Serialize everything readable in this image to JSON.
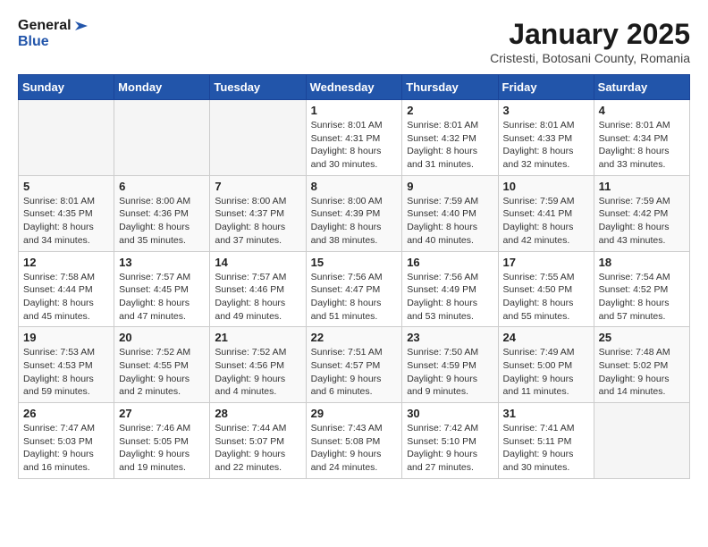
{
  "header": {
    "logo_general": "General",
    "logo_blue": "Blue",
    "month_title": "January 2025",
    "subtitle": "Cristesti, Botosani County, Romania"
  },
  "weekdays": [
    "Sunday",
    "Monday",
    "Tuesday",
    "Wednesday",
    "Thursday",
    "Friday",
    "Saturday"
  ],
  "weeks": [
    [
      {
        "day": "",
        "sunrise": "",
        "sunset": "",
        "daylight": ""
      },
      {
        "day": "",
        "sunrise": "",
        "sunset": "",
        "daylight": ""
      },
      {
        "day": "",
        "sunrise": "",
        "sunset": "",
        "daylight": ""
      },
      {
        "day": "1",
        "sunrise": "Sunrise: 8:01 AM",
        "sunset": "Sunset: 4:31 PM",
        "daylight": "Daylight: 8 hours and 30 minutes."
      },
      {
        "day": "2",
        "sunrise": "Sunrise: 8:01 AM",
        "sunset": "Sunset: 4:32 PM",
        "daylight": "Daylight: 8 hours and 31 minutes."
      },
      {
        "day": "3",
        "sunrise": "Sunrise: 8:01 AM",
        "sunset": "Sunset: 4:33 PM",
        "daylight": "Daylight: 8 hours and 32 minutes."
      },
      {
        "day": "4",
        "sunrise": "Sunrise: 8:01 AM",
        "sunset": "Sunset: 4:34 PM",
        "daylight": "Daylight: 8 hours and 33 minutes."
      }
    ],
    [
      {
        "day": "5",
        "sunrise": "Sunrise: 8:01 AM",
        "sunset": "Sunset: 4:35 PM",
        "daylight": "Daylight: 8 hours and 34 minutes."
      },
      {
        "day": "6",
        "sunrise": "Sunrise: 8:00 AM",
        "sunset": "Sunset: 4:36 PM",
        "daylight": "Daylight: 8 hours and 35 minutes."
      },
      {
        "day": "7",
        "sunrise": "Sunrise: 8:00 AM",
        "sunset": "Sunset: 4:37 PM",
        "daylight": "Daylight: 8 hours and 37 minutes."
      },
      {
        "day": "8",
        "sunrise": "Sunrise: 8:00 AM",
        "sunset": "Sunset: 4:39 PM",
        "daylight": "Daylight: 8 hours and 38 minutes."
      },
      {
        "day": "9",
        "sunrise": "Sunrise: 7:59 AM",
        "sunset": "Sunset: 4:40 PM",
        "daylight": "Daylight: 8 hours and 40 minutes."
      },
      {
        "day": "10",
        "sunrise": "Sunrise: 7:59 AM",
        "sunset": "Sunset: 4:41 PM",
        "daylight": "Daylight: 8 hours and 42 minutes."
      },
      {
        "day": "11",
        "sunrise": "Sunrise: 7:59 AM",
        "sunset": "Sunset: 4:42 PM",
        "daylight": "Daylight: 8 hours and 43 minutes."
      }
    ],
    [
      {
        "day": "12",
        "sunrise": "Sunrise: 7:58 AM",
        "sunset": "Sunset: 4:44 PM",
        "daylight": "Daylight: 8 hours and 45 minutes."
      },
      {
        "day": "13",
        "sunrise": "Sunrise: 7:57 AM",
        "sunset": "Sunset: 4:45 PM",
        "daylight": "Daylight: 8 hours and 47 minutes."
      },
      {
        "day": "14",
        "sunrise": "Sunrise: 7:57 AM",
        "sunset": "Sunset: 4:46 PM",
        "daylight": "Daylight: 8 hours and 49 minutes."
      },
      {
        "day": "15",
        "sunrise": "Sunrise: 7:56 AM",
        "sunset": "Sunset: 4:47 PM",
        "daylight": "Daylight: 8 hours and 51 minutes."
      },
      {
        "day": "16",
        "sunrise": "Sunrise: 7:56 AM",
        "sunset": "Sunset: 4:49 PM",
        "daylight": "Daylight: 8 hours and 53 minutes."
      },
      {
        "day": "17",
        "sunrise": "Sunrise: 7:55 AM",
        "sunset": "Sunset: 4:50 PM",
        "daylight": "Daylight: 8 hours and 55 minutes."
      },
      {
        "day": "18",
        "sunrise": "Sunrise: 7:54 AM",
        "sunset": "Sunset: 4:52 PM",
        "daylight": "Daylight: 8 hours and 57 minutes."
      }
    ],
    [
      {
        "day": "19",
        "sunrise": "Sunrise: 7:53 AM",
        "sunset": "Sunset: 4:53 PM",
        "daylight": "Daylight: 8 hours and 59 minutes."
      },
      {
        "day": "20",
        "sunrise": "Sunrise: 7:52 AM",
        "sunset": "Sunset: 4:55 PM",
        "daylight": "Daylight: 9 hours and 2 minutes."
      },
      {
        "day": "21",
        "sunrise": "Sunrise: 7:52 AM",
        "sunset": "Sunset: 4:56 PM",
        "daylight": "Daylight: 9 hours and 4 minutes."
      },
      {
        "day": "22",
        "sunrise": "Sunrise: 7:51 AM",
        "sunset": "Sunset: 4:57 PM",
        "daylight": "Daylight: 9 hours and 6 minutes."
      },
      {
        "day": "23",
        "sunrise": "Sunrise: 7:50 AM",
        "sunset": "Sunset: 4:59 PM",
        "daylight": "Daylight: 9 hours and 9 minutes."
      },
      {
        "day": "24",
        "sunrise": "Sunrise: 7:49 AM",
        "sunset": "Sunset: 5:00 PM",
        "daylight": "Daylight: 9 hours and 11 minutes."
      },
      {
        "day": "25",
        "sunrise": "Sunrise: 7:48 AM",
        "sunset": "Sunset: 5:02 PM",
        "daylight": "Daylight: 9 hours and 14 minutes."
      }
    ],
    [
      {
        "day": "26",
        "sunrise": "Sunrise: 7:47 AM",
        "sunset": "Sunset: 5:03 PM",
        "daylight": "Daylight: 9 hours and 16 minutes."
      },
      {
        "day": "27",
        "sunrise": "Sunrise: 7:46 AM",
        "sunset": "Sunset: 5:05 PM",
        "daylight": "Daylight: 9 hours and 19 minutes."
      },
      {
        "day": "28",
        "sunrise": "Sunrise: 7:44 AM",
        "sunset": "Sunset: 5:07 PM",
        "daylight": "Daylight: 9 hours and 22 minutes."
      },
      {
        "day": "29",
        "sunrise": "Sunrise: 7:43 AM",
        "sunset": "Sunset: 5:08 PM",
        "daylight": "Daylight: 9 hours and 24 minutes."
      },
      {
        "day": "30",
        "sunrise": "Sunrise: 7:42 AM",
        "sunset": "Sunset: 5:10 PM",
        "daylight": "Daylight: 9 hours and 27 minutes."
      },
      {
        "day": "31",
        "sunrise": "Sunrise: 7:41 AM",
        "sunset": "Sunset: 5:11 PM",
        "daylight": "Daylight: 9 hours and 30 minutes."
      },
      {
        "day": "",
        "sunrise": "",
        "sunset": "",
        "daylight": ""
      }
    ]
  ]
}
